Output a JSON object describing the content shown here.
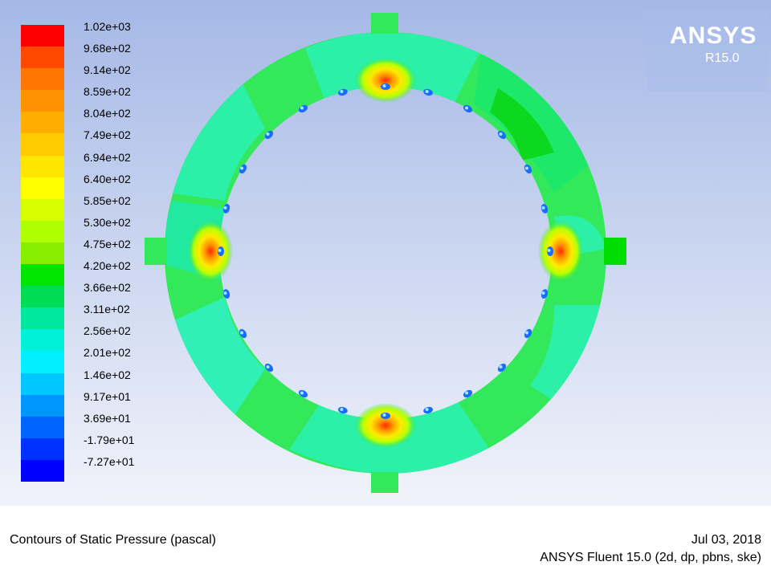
{
  "colorbar": {
    "labels": [
      "1.02e+03",
      "9.68e+02",
      "9.14e+02",
      "8.59e+02",
      "8.04e+02",
      "7.49e+02",
      "6.94e+02",
      "6.40e+02",
      "5.85e+02",
      "5.30e+02",
      "4.75e+02",
      "4.20e+02",
      "3.66e+02",
      "3.11e+02",
      "2.56e+02",
      "2.01e+02",
      "1.46e+02",
      "9.17e+01",
      "3.69e+01",
      "-1.79e+01",
      "-7.27e+01"
    ],
    "colors": [
      "#ff0000",
      "#ff4800",
      "#ff7600",
      "#ff9200",
      "#ffae00",
      "#ffca00",
      "#ffe600",
      "#ffff00",
      "#d8ff00",
      "#b0ff00",
      "#88ee00",
      "#00e600",
      "#00dd55",
      "#00e8a0",
      "#00f0d8",
      "#00f0ff",
      "#00c8ff",
      "#0096ff",
      "#0064ff",
      "#0032ff",
      "#0000ff"
    ]
  },
  "logo": {
    "brand": "ANSYS",
    "version": "R15.0"
  },
  "footer": {
    "title": "Contours of Static Pressure (pascal)",
    "date": "Jul 03, 2018",
    "solver": "ANSYS Fluent 15.0 (2d, dp, pbns, ske)"
  }
}
